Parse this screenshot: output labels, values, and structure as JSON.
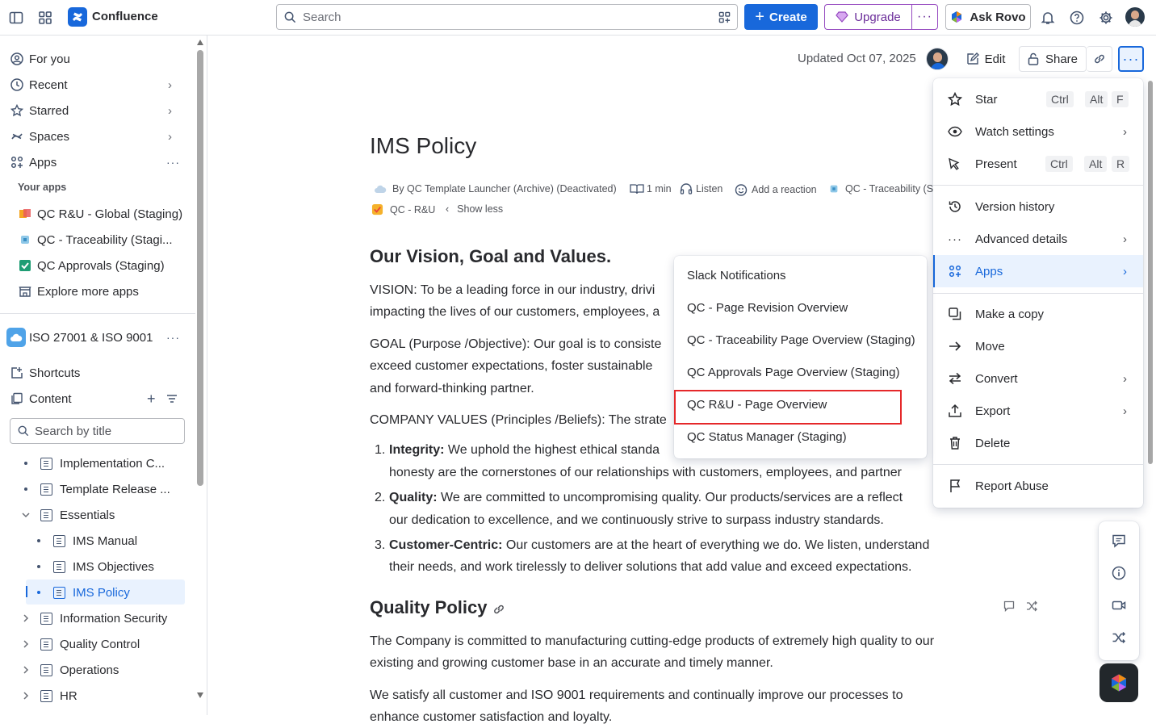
{
  "app": {
    "name": "Confluence"
  },
  "topbar": {
    "search_placeholder": "Search",
    "create_label": "Create",
    "upgrade_label": "Upgrade",
    "ask_rovo_label": "Ask Rovo"
  },
  "sidebar": {
    "nav": [
      {
        "label": "For you"
      },
      {
        "label": "Recent"
      },
      {
        "label": "Starred"
      },
      {
        "label": "Spaces"
      },
      {
        "label": "Apps"
      }
    ],
    "your_apps_heading": "Your apps",
    "apps": [
      {
        "label": "QC R&U - Global (Staging)"
      },
      {
        "label": "QC - Traceability (Stagi..."
      },
      {
        "label": "QC Approvals (Staging)"
      },
      {
        "label": "Explore more apps"
      }
    ],
    "space_name": "ISO 27001 & ISO 9001",
    "shortcuts_label": "Shortcuts",
    "content_label": "Content",
    "search_by_title_placeholder": "Search by title",
    "tree": [
      {
        "label": "Implementation C..."
      },
      {
        "label": "Template Release ..."
      },
      {
        "label": "Essentials"
      },
      {
        "label": "IMS Manual"
      },
      {
        "label": "IMS Objectives"
      },
      {
        "label": "IMS Policy"
      },
      {
        "label": "Information Security"
      },
      {
        "label": "Quality Control"
      },
      {
        "label": "Operations"
      },
      {
        "label": "HR"
      }
    ]
  },
  "page_header": {
    "updated": "Updated Oct 07, 2025",
    "edit_label": "Edit",
    "share_label": "Share"
  },
  "page": {
    "title": "IMS Policy",
    "byline": "By QC Template Launcher (Archive) (Deactivated)",
    "read_time": "1 min",
    "listen": "Listen",
    "add_reaction": "Add a reaction",
    "traceability": "QC - Traceability (S",
    "qc_ru": "QC - R&U",
    "show_less": "Show less",
    "h_vision": "Our Vision, Goal and Values.",
    "vision_1": "VISION: To be a leading force in our industry, drivi",
    "vision_2": "impacting the lives of our customers, employees, a",
    "goal_1": "GOAL (Purpose /Objective): Our goal is to consiste",
    "goal_2": "exceed customer expectations, foster sustainable",
    "goal_3": "and forward-thinking partner.",
    "values": "COMPANY VALUES (Principles /Beliefs): The strate",
    "li1_bold": "Integrity:",
    "li1_1": " We uphold the highest ethical standa",
    "li1_2": "honesty are the cornerstones of our relationships with customers, employees, and partner",
    "li2_bold": "Quality:",
    "li2_1": " We are committed to uncompromising quality. Our products/services are a reflect",
    "li2_2": "our dedication to excellence, and we continuously strive to surpass industry standards.",
    "li3_bold": "Customer-Centric:",
    "li3_1": " Our customers are at the heart of everything we do. We listen, understand",
    "li3_2": "their needs, and work tirelessly to deliver solutions that add value and exceed expectations.",
    "h_quality": "Quality Policy",
    "q1": "The Company is committed to manufacturing cutting-edge products of extremely high quality to our",
    "q2": "existing and growing customer base in an accurate and timely manner.",
    "q3": "We satisfy all customer and ISO 9001 requirements and continually improve our processes to",
    "q4": "enhance customer satisfaction and loyalty."
  },
  "more_menu": {
    "star": "Star",
    "star_keys": [
      "Ctrl",
      "Alt",
      "F"
    ],
    "watch": "Watch settings",
    "present": "Present",
    "present_keys": [
      "Ctrl",
      "Alt",
      "R"
    ],
    "version_history": "Version history",
    "advanced_details": "Advanced details",
    "apps": "Apps",
    "make_copy": "Make a copy",
    "move": "Move",
    "convert": "Convert",
    "export": "Export",
    "delete": "Delete",
    "report_abuse": "Report Abuse"
  },
  "apps_submenu": [
    {
      "label": "Slack Notifications"
    },
    {
      "label": "QC - Page Revision Overview"
    },
    {
      "label": "QC - Traceability Page Overview (Staging)"
    },
    {
      "label": "QC Approvals Page Overview (Staging)"
    },
    {
      "label": "QC R&U - Page Overview"
    },
    {
      "label": "QC Status Manager (Staging)"
    }
  ],
  "colors": {
    "accent": "#1868db",
    "highlight_box": "#e5282a",
    "selected_bg": "#e9f2fe",
    "upgrade_purple": "#964ac0"
  }
}
